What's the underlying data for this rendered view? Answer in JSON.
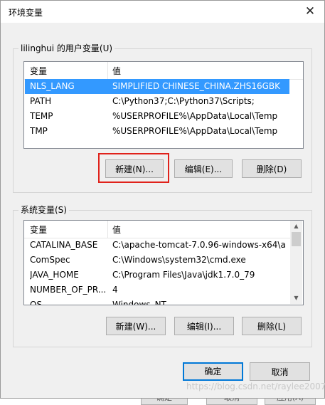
{
  "window": {
    "title": "环境变量",
    "close_label": "✕"
  },
  "user_vars": {
    "group_label": "lilinghui 的用户变量(U)",
    "col_name": "变量",
    "col_value": "值",
    "rows": [
      {
        "name": "NLS_LANG",
        "value": "SIMPLIFIED CHINESE_CHINA.ZHS16GBK"
      },
      {
        "name": "PATH",
        "value": "C:\\Python37;C:\\Python37\\Scripts;"
      },
      {
        "name": "TEMP",
        "value": "%USERPROFILE%\\AppData\\Local\\Temp"
      },
      {
        "name": "TMP",
        "value": "%USERPROFILE%\\AppData\\Local\\Temp"
      }
    ],
    "selected_row": "NLS_LANG",
    "buttons": {
      "new": "新建(N)...",
      "edit": "编辑(E)...",
      "delete": "删除(D)"
    }
  },
  "system_vars": {
    "group_label": "系统变量(S)",
    "col_name": "变量",
    "col_value": "值",
    "rows": [
      {
        "name": "CATALINA_BASE",
        "value": "C:\\apache-tomcat-7.0.96-windows-x64\\a..."
      },
      {
        "name": "ComSpec",
        "value": "C:\\Windows\\system32\\cmd.exe"
      },
      {
        "name": "JAVA_HOME",
        "value": "C:\\Program Files\\Java\\jdk1.7.0_79"
      },
      {
        "name": "NUMBER_OF_PR...",
        "value": "4"
      },
      {
        "name": "OS",
        "value": "Windows_NT"
      }
    ],
    "buttons": {
      "new": "新建(W)...",
      "edit": "编辑(I)...",
      "delete": "删除(L)"
    }
  },
  "footer": {
    "ok": "确定",
    "cancel": "取消"
  },
  "background": {
    "ok": "确定",
    "cancel": "取消",
    "apply": "应用(A)"
  },
  "watermark": "https://blog.csdn.net/raylee2007",
  "colors": {
    "selection": "#3399ff",
    "highlight_border": "#e0221b",
    "default_button_border": "#0078d7"
  }
}
